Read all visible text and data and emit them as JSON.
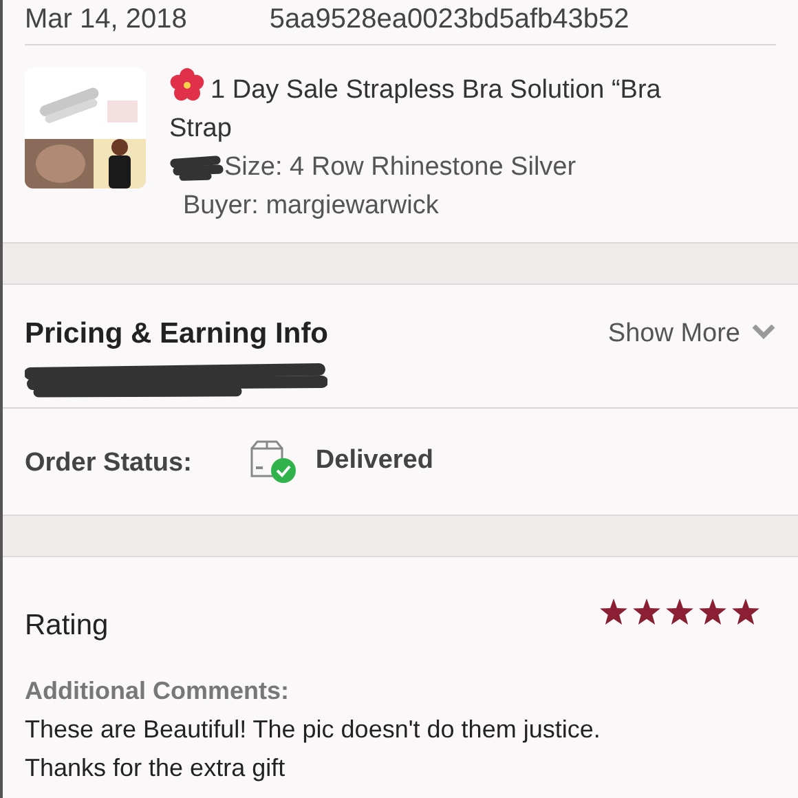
{
  "order_header": {
    "date": "Mar 14, 2018",
    "order_id": "5aa9528ea0023bd5afb43b52"
  },
  "item": {
    "title": "1 Day Sale Strapless Bra Solution “Bra Strap",
    "size": "Size: 4 Row Rhinestone Silver",
    "buyer": "Buyer: margiewarwick"
  },
  "pricing": {
    "title": "Pricing & Earning Info",
    "toggle": "Show More"
  },
  "order_status": {
    "label": "Order Status:",
    "value": "Delivered"
  },
  "rating": {
    "title": "Rating",
    "stars": 5,
    "comments_label": "Additional Comments:",
    "comments": "These are Beautiful! The pic doesn't do them justice. Thanks for the extra gift"
  }
}
